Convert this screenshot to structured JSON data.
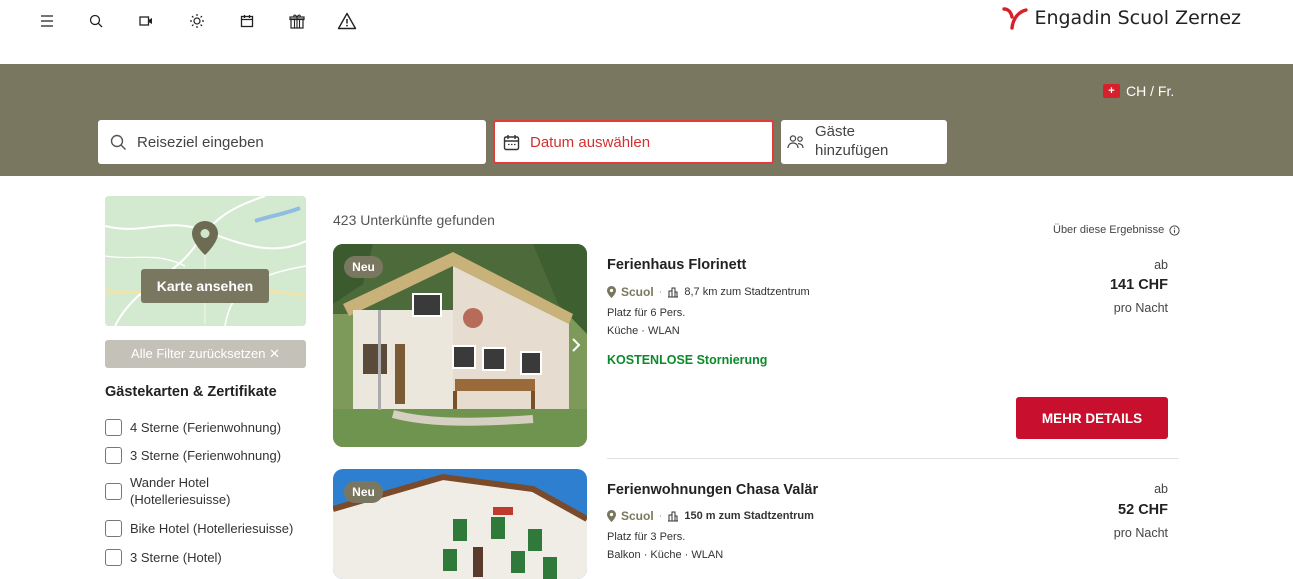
{
  "topnav": {
    "icons": [
      "menu-icon",
      "search-icon",
      "video-icon",
      "sun-icon",
      "calendar-icon",
      "gift-icon",
      "warning-icon"
    ],
    "brand": "Engadin Scuol Zernez"
  },
  "locale": {
    "flag_label": "CH",
    "text": "CH / Fr."
  },
  "search": {
    "destination_placeholder": "Reiseziel eingeben",
    "date_label": "Datum auswählen",
    "guests_line1": "Gäste",
    "guests_line2": "hinzufügen"
  },
  "sidebar": {
    "map_button": "Karte ansehen",
    "reset_filters": "Alle Filter zurücksetzen  ✕",
    "filter_group_title": "Gästekarten & Zertifikate",
    "filters": [
      {
        "line1": "4 Sterne (Ferienwohnung)",
        "line2": ""
      },
      {
        "line1": "3 Sterne (Ferienwohnung)",
        "line2": ""
      },
      {
        "line1": "Wander Hotel",
        "line2": "(Hotelleriesuisse)"
      },
      {
        "line1": "Bike Hotel (Hotelleriesuisse)",
        "line2": ""
      },
      {
        "line1": "3 Sterne (Hotel)",
        "line2": ""
      }
    ]
  },
  "results": {
    "count_text": "423 Unterkünfte gefunden",
    "about_text": "Über diese Ergebnisse",
    "items": [
      {
        "badge": "Neu",
        "title": "Ferienhaus Florinett",
        "city": "Scuol",
        "distance": "8,7 km zum Stadtzentrum",
        "capacity": "Platz für 6 Pers.",
        "amenities": "Küche · WLAN",
        "cancellation": "KOSTENLOSE Stornierung",
        "price_prefix": "ab",
        "price": "141 CHF",
        "price_unit": "pro Nacht",
        "details_button": "MEHR DETAILS"
      },
      {
        "badge": "Neu",
        "title": "Ferienwohnungen Chasa Valär",
        "city": "Scuol",
        "distance": "150 m zum Stadtzentrum",
        "capacity": "Platz für 3 Pers.",
        "amenities": "Balkon · Küche · WLAN",
        "price_prefix": "ab",
        "price": "52 CHF",
        "price_unit": "pro Nacht"
      }
    ]
  },
  "colors": {
    "olive": "#7a7760",
    "accent_red": "#c8102e",
    "date_red": "#e23b3b",
    "green": "#0a8a2a"
  }
}
